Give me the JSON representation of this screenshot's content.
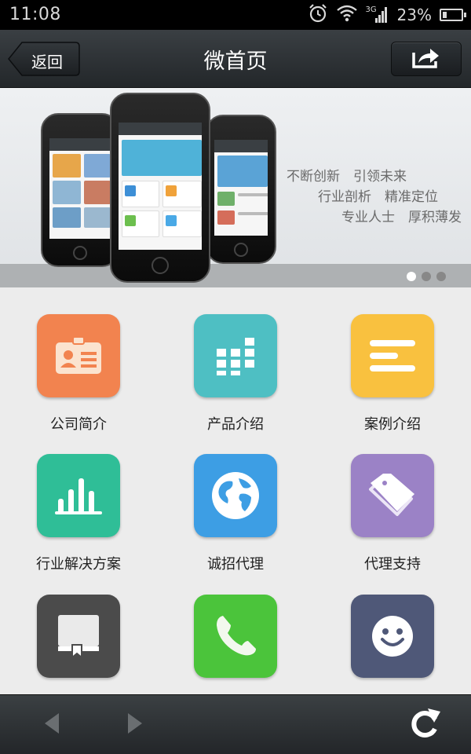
{
  "status_bar": {
    "time": "11:08",
    "network": "3G",
    "battery_percent": "23%",
    "battery_level": 0.23,
    "icons": [
      "alarm-icon",
      "wifi-icon",
      "signal-icon",
      "battery-icon"
    ]
  },
  "title_bar": {
    "title": "微首页",
    "back_label": "返回",
    "share_icon": "share-icon"
  },
  "banner": {
    "slogans": [
      "不断创新　引领未来",
      "行业剖析　精准定位",
      "专业人士　厚积薄发"
    ],
    "slide_count": 3,
    "active_slide": 1
  },
  "grid": {
    "items": [
      {
        "label": "公司简介",
        "icon": "id-card-icon",
        "color": "#f2834f"
      },
      {
        "label": "产品介绍",
        "icon": "grid-blocks-icon",
        "color": "#4ebfc3"
      },
      {
        "label": "案例介绍",
        "icon": "list-lines-icon",
        "color": "#f9c13f"
      },
      {
        "label": "行业解决方案",
        "icon": "bar-chart-icon",
        "color": "#2fbe97"
      },
      {
        "label": "诚招代理",
        "icon": "globe-icon",
        "color": "#3d9ee4"
      },
      {
        "label": "代理支持",
        "icon": "tags-icon",
        "color": "#9b82c6"
      },
      {
        "label": "",
        "icon": "book-icon",
        "color": "#4b4b4b"
      },
      {
        "label": "",
        "icon": "phone-icon",
        "color": "#4bc43b"
      },
      {
        "label": "",
        "icon": "smiley-icon",
        "color": "#4f5878"
      }
    ]
  },
  "toolbar": {
    "icons": [
      "back-arrow-icon",
      "forward-arrow-icon",
      "refresh-icon"
    ]
  }
}
